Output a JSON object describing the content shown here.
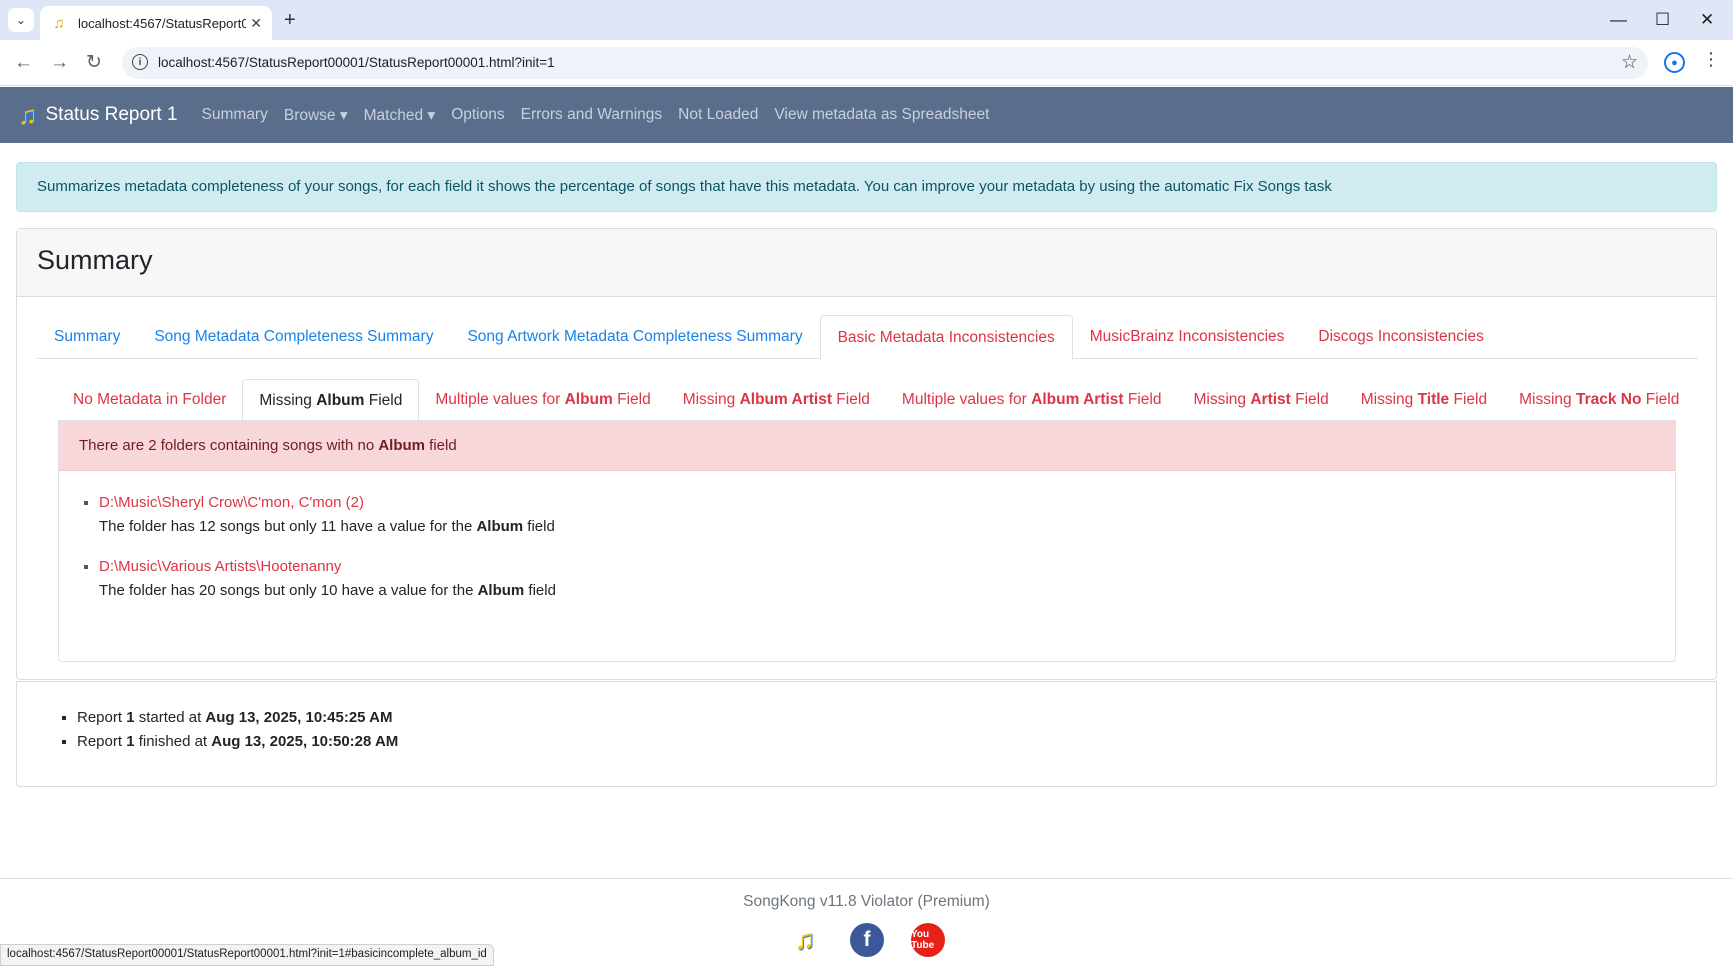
{
  "browser": {
    "tab_title": "localhost:4567/StatusReport00001/StatusReport00001.html?init=1",
    "url": "localhost:4567/StatusReport00001/StatusReport00001.html?init=1",
    "status_url": "localhost:4567/StatusReport00001/StatusReport00001.html?init=1#basicincomplete_album_id"
  },
  "navbar": {
    "brand": "Status Report 1",
    "links": [
      "Summary",
      "Browse ▾",
      "Matched ▾",
      "Options",
      "Errors and Warnings",
      "Not Loaded",
      "View metadata as Spreadsheet"
    ]
  },
  "info_alert": "Summarizes metadata completeness of your songs, for each field it shows the percentage of songs that have this metadata. You can improve your metadata by using the automatic Fix Songs task",
  "card": {
    "title": "Summary",
    "tabs": [
      "Summary",
      "Song Metadata Completeness Summary",
      "Song Artwork Metadata Completeness Summary",
      "Basic Metadata Inconsistencies",
      "MusicBrainz Inconsistencies",
      "Discogs Inconsistencies"
    ],
    "subtabs": [
      {
        "pre": "No Metadata in Folder",
        "bold": "",
        "post": ""
      },
      {
        "pre": "Missing ",
        "bold": "Album",
        "post": " Field"
      },
      {
        "pre": "Multiple values for ",
        "bold": "Album",
        "post": " Field"
      },
      {
        "pre": "Missing ",
        "bold": "Album Artist",
        "post": " Field"
      },
      {
        "pre": "Multiple values for ",
        "bold": "Album Artist",
        "post": " Field"
      },
      {
        "pre": "Missing ",
        "bold": "Artist",
        "post": " Field"
      },
      {
        "pre": "Missing ",
        "bold": "Title",
        "post": " Field"
      },
      {
        "pre": "Missing ",
        "bold": "Track No",
        "post": " Field"
      }
    ],
    "alert": {
      "pre": "There are 2 folders containing songs with no ",
      "bold": "Album",
      "post": " field"
    },
    "folders": [
      {
        "path": "D:\\Music\\Sheryl Crow\\C'mon, C'mon (2)",
        "pre": "The folder has 12 songs but only 11 have a value for the ",
        "bold": "Album",
        "post": " field"
      },
      {
        "path": "D:\\Music\\Various Artists\\Hootenanny",
        "pre": "The folder has 20 songs but only 10 have a value for the ",
        "bold": "Album",
        "post": " field"
      }
    ]
  },
  "report": {
    "started": {
      "pre": "Report ",
      "num": "1",
      "mid": " started at ",
      "time": "Aug 13, 2025, 10:45:25 AM"
    },
    "finished": {
      "pre": "Report ",
      "num": "1",
      "mid": " finished at ",
      "time": "Aug 13, 2025, 10:50:28 AM"
    }
  },
  "footer": {
    "version": "SongKong v11.8 Violator (Premium)",
    "icons": [
      "music-note-icon",
      "facebook-icon",
      "youtube-icon"
    ],
    "youtube_text": "You Tube"
  },
  "colors": {
    "navbar": "#5a6e8b",
    "link_blue": "#1a82e8",
    "link_red": "#dc3545",
    "info_bg": "#d1ecf1",
    "danger_bg": "#f8d7da"
  }
}
